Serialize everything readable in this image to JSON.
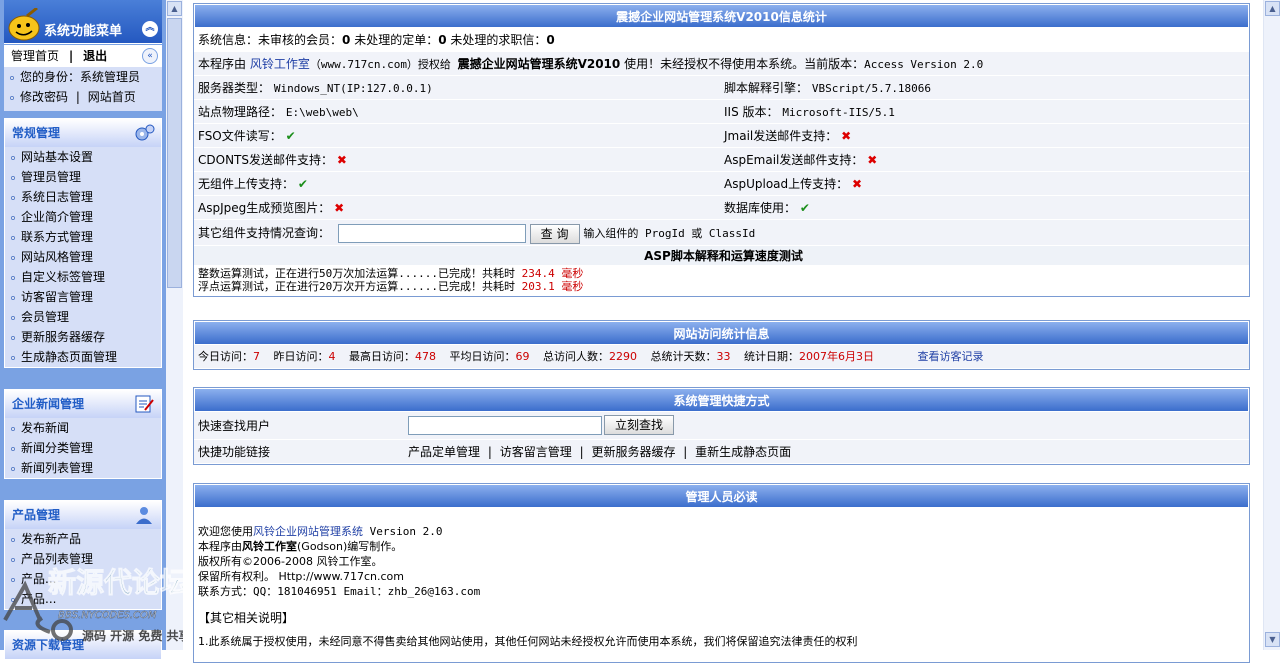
{
  "sidebar": {
    "title": "系统功能菜单",
    "tabs": {
      "home": "管理首页",
      "sep": "|",
      "logout": "退出"
    },
    "identity": "您的身份：系统管理员",
    "change_pwd": "修改密码",
    "site_home": "网站首页",
    "pipe": "|",
    "sections": [
      {
        "title": "常规管理",
        "items": [
          "网站基本设置",
          "管理员管理",
          "系统日志管理",
          "企业简介管理",
          "联系方式管理",
          "网站风格管理",
          "自定义标签管理",
          "访客留言管理",
          "会员管理",
          "更新服务器缓存",
          "生成静态页面管理"
        ]
      },
      {
        "title": "企业新闻管理",
        "items": [
          "发布新闻",
          "新闻分类管理",
          "新闻列表管理"
        ]
      },
      {
        "title": "产品管理",
        "items": [
          "发布新产品",
          "产品列表管理",
          "产品...",
          "产品..."
        ]
      },
      {
        "title": "资源下载管理",
        "items": []
      }
    ]
  },
  "stats": {
    "header": "震撼企业网站管理系统V2010信息统计",
    "sysinfo": {
      "lead": "系统信息：未审核的会员：",
      "v1": "0",
      "mid1": " 未处理的定单：",
      "v2": "0",
      "mid2": " 未处理的求职信：",
      "v3": "0"
    },
    "license": {
      "a": "本程序由 ",
      "studio": "风铃工作室",
      "b": "（www.717cn.com）授权给 ",
      "product": "震撼企业网站管理系统V2010",
      "c": " 使用！未经授权不得使用本系统。当前版本：",
      "version": "Access Version 2.0"
    },
    "rows": [
      {
        "l_label": "服务器类型：",
        "l_val": "Windows_NT(IP:127.0.0.1)",
        "r_label": "脚本解释引擎：",
        "r_val": "VBScript/5.7.18066"
      },
      {
        "l_label": "站点物理路径：",
        "l_val": "E:\\web\\web\\",
        "r_label": "IIS 版本：",
        "r_val": "Microsoft-IIS/5.1"
      },
      {
        "l_label": "FSO文件读写：",
        "l_val": "✔",
        "r_label": "Jmail发送邮件支持：",
        "r_val": "✖"
      },
      {
        "l_label": "CDONTS发送邮件支持：",
        "l_val": "✖",
        "r_label": "AspEmail发送邮件支持：",
        "r_val": "✖"
      },
      {
        "l_label": "无组件上传支持：",
        "l_val": "✔",
        "r_label": "AspUpload上传支持：",
        "r_val": "✖"
      },
      {
        "l_label": "AspJpeg生成预览图片：",
        "l_val": "✖",
        "r_label": "数据库使用：",
        "r_val": "✔"
      }
    ],
    "component_query": {
      "label": "其它组件支持情况查询：",
      "button": "查 询",
      "hint": "输入组件的 ProgId 或 ClassId",
      "value": ""
    },
    "speed_title": "ASP脚本解释和运算速度测试",
    "int_test": {
      "text": "整数运算测试，正在进行50万次加法运算......已完成！共耗时 ",
      "time": "234.4 毫秒"
    },
    "float_test": {
      "text": "浮点运算测试，正在进行20万次开方运算......已完成！共耗时 ",
      "time": "203.1 毫秒"
    }
  },
  "visits": {
    "header": "网站访问统计信息",
    "today_label": "今日访问：",
    "today": "7",
    "yesterday_label": "昨日访问：",
    "yesterday": "4",
    "max_label": "最高日访问：",
    "max": "478",
    "avg_label": "平均日访问：",
    "avg": "69",
    "total_label": "总访问人数：",
    "total": "2290",
    "days_label": "总统计天数：",
    "days": "33",
    "date_label": "统计日期：",
    "date": "2007年6月3日",
    "view_link": "查看访客记录"
  },
  "shortcuts": {
    "header": "系统管理快捷方式",
    "search_label": "快速查找用户",
    "search_value": "",
    "search_button": "立刻查找",
    "links_label": "快捷功能链接",
    "links": [
      "产品定单管理",
      "访客留言管理",
      "更新服务器缓存",
      "重新生成静态页面"
    ],
    "pipe": "|"
  },
  "notice": {
    "header": "管理人员必读",
    "welcome_a": "欢迎您使用",
    "welcome_link": "风铃企业网站管理系统",
    "welcome_b": " Version 2.0",
    "line2_a": "本程序由",
    "line2_b": "风铃工作室",
    "line2_c": "(Godson)编写制作。",
    "line3": "版权所有©2006-2008 风铃工作室。",
    "line4": "保留所有权利。 Http://www.717cn.com",
    "line5": "联系方式：QQ：181046951 Email：zhb_26@163.com",
    "other_title": "【其它相关说明】",
    "other_1": "1.此系统属于授权使用，未经同意不得售卖给其他网站使用，其他任何网站未经授权允许而使用本系统，我们将保留追究法律责任的权利"
  },
  "watermark": {
    "text": "新源代论坛",
    "url": "BBS.NYCODES.COM",
    "slogan": "源码 开源 免费 共享"
  },
  "colors": {
    "accent": "#215dc6",
    "header_blue": "#3b6dcc",
    "ok_green": "#1b8e1b",
    "error_red": "#dd0000"
  }
}
